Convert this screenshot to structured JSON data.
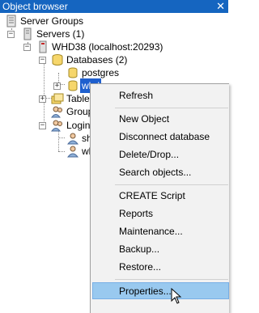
{
  "window": {
    "title": "Object browser",
    "close_glyph": "✕"
  },
  "tree": {
    "server_groups": "Server Groups",
    "servers": "Servers (1)",
    "server": "WHD38 (localhost:20293)",
    "databases": "Databases (2)",
    "db_postgres": "postgres",
    "db_selected": "whd",
    "tablespaces": "Tables",
    "group_roles": "Group",
    "login_roles": "Login",
    "login_1": "sh",
    "login_2": "wh"
  },
  "context_menu": {
    "items": [
      {
        "label": "Refresh"
      },
      {
        "label": "New Object"
      },
      {
        "label": "Disconnect database"
      },
      {
        "label": "Delete/Drop..."
      },
      {
        "label": "Search objects..."
      },
      {
        "label": "CREATE Script"
      },
      {
        "label": "Reports"
      },
      {
        "label": "Maintenance..."
      },
      {
        "label": "Backup..."
      },
      {
        "label": "Restore..."
      },
      {
        "label": "Properties..."
      }
    ]
  },
  "colors": {
    "titlebar": "#1565c0",
    "selection": "#1e5fce",
    "menu_hover": "#99c9ef"
  }
}
